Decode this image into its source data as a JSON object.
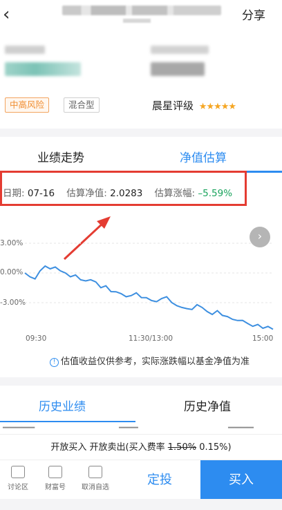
{
  "header": {
    "share_label": "分享",
    "back_glyph": "‹"
  },
  "tags": {
    "risk": "中高风险",
    "type": "混合型"
  },
  "rating": {
    "label": "晨星评级",
    "stars": "★★★★★"
  },
  "tabs": {
    "performance": "业绩走势",
    "estimate": "净值估算"
  },
  "estimate_info": {
    "date_label": "日期:",
    "date": "07-16",
    "nav_label": "估算净值:",
    "nav": "2.0283",
    "change_label": "估算涨幅:",
    "change": "–5.59%"
  },
  "colors": {
    "accent": "#2d8cf0",
    "down": "#19a35c",
    "highlight_box": "#e43c32",
    "risk_tag": "#f08c2e"
  },
  "chart_data": {
    "type": "line",
    "ytick_labels": [
      "3.00%",
      "0.00%",
      "-3.00%"
    ],
    "xtick_labels": [
      "09:30",
      "11:30/13:00",
      "15:00"
    ],
    "ylim": [
      -6,
      4
    ],
    "series": [
      {
        "values": [
          0.0,
          -0.3,
          -0.6,
          0.3,
          0.7,
          0.5,
          0.6,
          0.3,
          0.0,
          -0.3,
          -0.2,
          -0.6,
          -0.8,
          -0.6,
          -0.9,
          -1.4,
          -1.3,
          -1.8,
          -1.9,
          -2.0,
          -2.4,
          -2.2,
          -2.0,
          -2.4,
          -2.5,
          -2.7,
          -2.9,
          -2.5,
          -2.4,
          -2.9,
          -3.3,
          -3.4,
          -3.6,
          -3.6,
          -3.2,
          -3.4,
          -3.9,
          -4.1,
          -3.8,
          -4.2,
          -4.4,
          -4.6,
          -4.8,
          -4.7,
          -5.1,
          -5.3,
          -5.2,
          -5.5,
          -5.4,
          -5.6
        ]
      }
    ]
  },
  "notice": {
    "icon": "info-icon",
    "text": "估值收益仅供参考，实际涨跌幅以基金净值为准"
  },
  "tabs2": {
    "history_perf": "历史业绩",
    "history_nav": "历史净值"
  },
  "buy_info": {
    "prefix": "开放买入 开放卖出(买入费率",
    "old_rate": "1.50%",
    "new_rate": "0.15%)"
  },
  "bottom": {
    "discuss": "讨论区",
    "caifuhao": "财富号",
    "unfav": "取消自选",
    "dingtou": "定投",
    "buy": "买入"
  }
}
